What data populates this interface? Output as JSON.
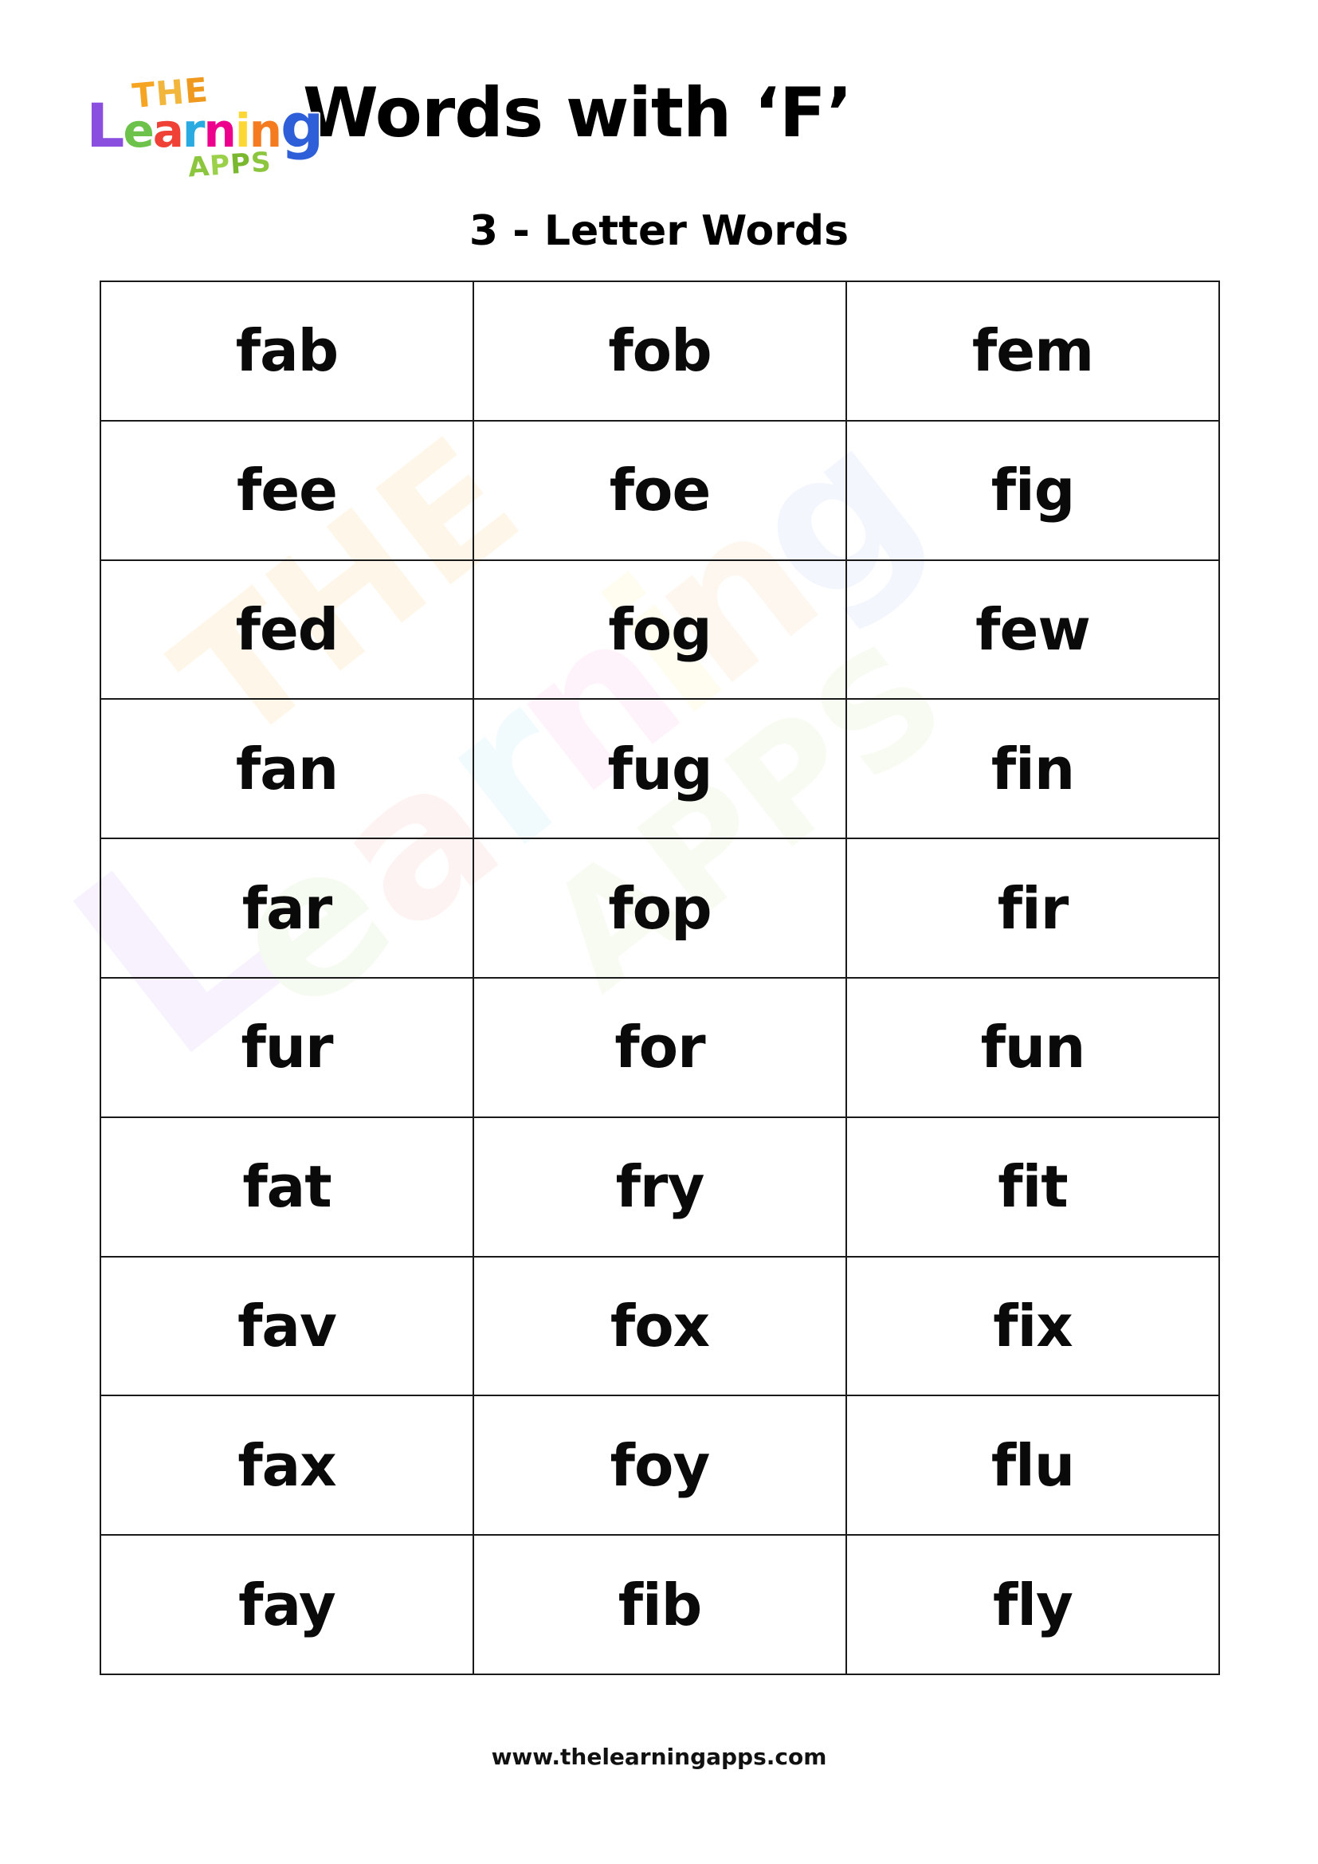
{
  "header": {
    "title": "Words with ‘F’",
    "subtitle": "3 - Letter Words",
    "logo": {
      "line1": "THE",
      "line2": "Learning",
      "line3": "APPS",
      "colors": {
        "the": "#f5a623",
        "L": "#8b4fe0",
        "e": "#6cc24a",
        "a": "#ef4136",
        "r": "#29abe2",
        "n1": "#ec008c",
        "i": "#fdd835",
        "n2": "#f47b20",
        "g": "#2e5fd9",
        "apps": "#8cc63f"
      }
    }
  },
  "table": {
    "columns": 3,
    "rows": [
      [
        "fab",
        "fob",
        "fem"
      ],
      [
        "fee",
        "foe",
        "fig"
      ],
      [
        "fed",
        "fog",
        "few"
      ],
      [
        "fan",
        "fug",
        "fin"
      ],
      [
        "far",
        "fop",
        "fir"
      ],
      [
        "fur",
        "for",
        "fun"
      ],
      [
        "fat",
        "fry",
        "fit"
      ],
      [
        "fav",
        "fox",
        "fix"
      ],
      [
        "fax",
        "foy",
        "flu"
      ],
      [
        "fay",
        "fib",
        "fly"
      ]
    ]
  },
  "watermark": {
    "line1": "THE",
    "line2": "Learning",
    "line3": "APPS"
  },
  "footer": {
    "url": "www.thelearningapps.com"
  },
  "colors": {
    "page_background": "#ffffff",
    "table_border": "#1a1a1a",
    "text": "#000000"
  }
}
